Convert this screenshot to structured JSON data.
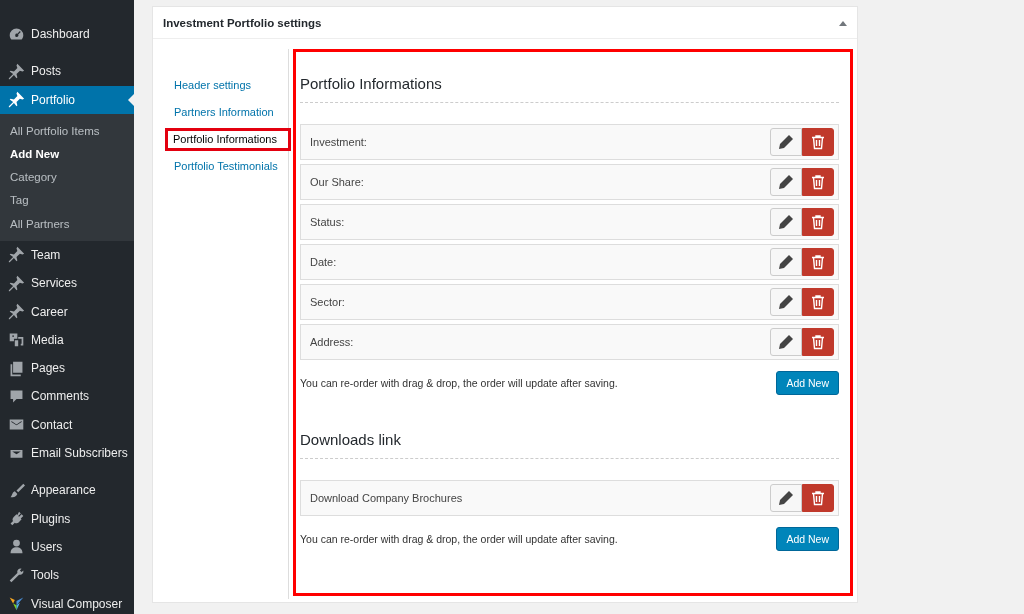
{
  "sidebar": {
    "groups": [
      [
        {
          "label": "Dashboard",
          "selected": false
        }
      ],
      [
        {
          "label": "Posts",
          "selected": false
        },
        {
          "label": "Portfolio",
          "selected": true,
          "children": [
            {
              "label": "All Portfolio Items",
              "selected": false
            },
            {
              "label": "Add New",
              "selected": true
            },
            {
              "label": "Category",
              "selected": false
            },
            {
              "label": "Tag",
              "selected": false
            },
            {
              "label": "All Partners",
              "selected": false
            }
          ]
        },
        {
          "label": "Team",
          "selected": false
        },
        {
          "label": "Services",
          "selected": false
        },
        {
          "label": "Career",
          "selected": false
        },
        {
          "label": "Media",
          "selected": false
        },
        {
          "label": "Pages",
          "selected": false
        },
        {
          "label": "Comments",
          "selected": false
        },
        {
          "label": "Contact",
          "selected": false
        },
        {
          "label": "Email Subscribers",
          "selected": false
        }
      ],
      [
        {
          "label": "Appearance",
          "selected": false
        },
        {
          "label": "Plugins",
          "selected": false
        },
        {
          "label": "Users",
          "selected": false
        },
        {
          "label": "Tools",
          "selected": false
        },
        {
          "label": "Visual Composer",
          "selected": false
        }
      ]
    ]
  },
  "panel": {
    "title": "Investment Portfolio settings",
    "tabs": [
      {
        "label": "Header settings",
        "selected": false
      },
      {
        "label": "Partners Information",
        "selected": false
      },
      {
        "label": "Portfolio Informations",
        "selected": true
      },
      {
        "label": "Portfolio Testimonials",
        "selected": false
      }
    ],
    "sections": [
      {
        "heading": "Portfolio Informations",
        "rows": [
          {
            "label": "Investment:"
          },
          {
            "label": "Our Share:"
          },
          {
            "label": "Status:"
          },
          {
            "label": "Date:"
          },
          {
            "label": "Sector:"
          },
          {
            "label": "Address:"
          }
        ],
        "note": "You can re-order with drag & drop, the order will update after saving.",
        "button": "Add New"
      },
      {
        "heading": "Downloads link",
        "rows": [
          {
            "label": "Download Company Brochures"
          }
        ],
        "note": "You can re-order with drag & drop, the order will update after saving.",
        "button": "Add New"
      }
    ]
  }
}
